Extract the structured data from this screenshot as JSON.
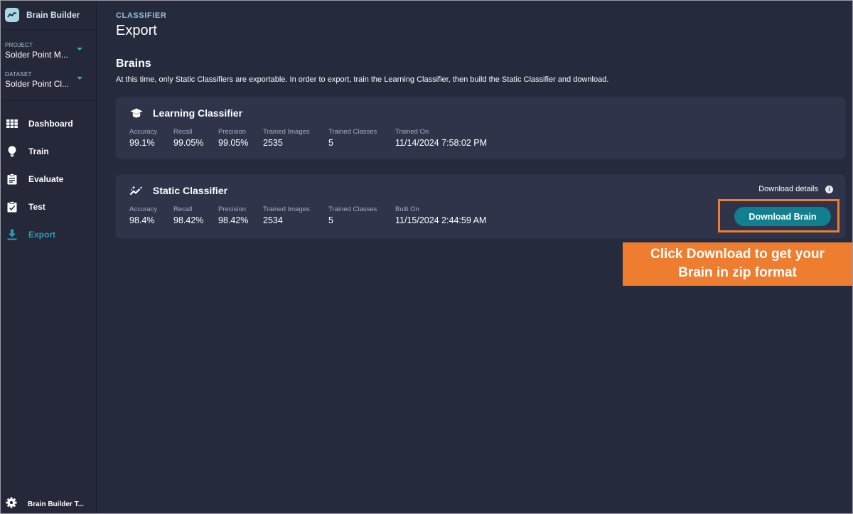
{
  "app": {
    "name": "Brain Builder",
    "logo_icon": "trend-line-icon"
  },
  "sidebar": {
    "project": {
      "label": "PROJECT",
      "value": "Solder Point M..."
    },
    "dataset": {
      "label": "DATASET",
      "value": "Solder Point Cl..."
    },
    "nav": [
      {
        "label": "Dashboard",
        "icon": "grid-icon",
        "active": false
      },
      {
        "label": "Train",
        "icon": "lightbulb-icon",
        "active": false
      },
      {
        "label": "Evaluate",
        "icon": "clipboard-list-icon",
        "active": false
      },
      {
        "label": "Test",
        "icon": "clipboard-check-icon",
        "active": false
      },
      {
        "label": "Export",
        "icon": "download-icon",
        "active": true
      }
    ],
    "footer": {
      "label": "Brain Builder T...",
      "icon": "gear-icon"
    }
  },
  "header": {
    "breadcrumb": "CLASSIFIER",
    "title": "Export"
  },
  "brains": {
    "title": "Brains",
    "description": "At this time, only Static Classifiers are exportable. In order to export, train the Learning Classifier, then build the Static Classifier and download."
  },
  "learning_classifier": {
    "title": "Learning Classifier",
    "icon": "graduation-cap-icon",
    "stats": [
      {
        "label": "Accuracy",
        "value": "99.1%"
      },
      {
        "label": "Recall",
        "value": "99.05%"
      },
      {
        "label": "Precision",
        "value": "99.05%"
      },
      {
        "label": "Trained Images",
        "value": "2535"
      },
      {
        "label": "Trained Classes",
        "value": "5"
      },
      {
        "label": "Trained On",
        "value": "11/14/2024 7:58:02 PM"
      }
    ]
  },
  "static_classifier": {
    "title": "Static Classifier",
    "icon": "sparkle-trend-icon",
    "stats": [
      {
        "label": "Accuracy",
        "value": "98.4%"
      },
      {
        "label": "Recall",
        "value": "98.42%"
      },
      {
        "label": "Precision",
        "value": "98.42%"
      },
      {
        "label": "Trained Images",
        "value": "2534"
      },
      {
        "label": "Trained Classes",
        "value": "5"
      },
      {
        "label": "Built On",
        "value": "11/15/2024 2:44:59 AM"
      }
    ],
    "download_details_label": "Download details",
    "download_button_label": "Download Brain"
  },
  "callout": {
    "line1": "Click Download to get your",
    "line2": "Brain in zip format"
  },
  "colors": {
    "background": "#262a3d",
    "card": "#30344b",
    "accent": "#2a9db8",
    "button": "#117f8e",
    "annotation": "#ee7d30"
  }
}
